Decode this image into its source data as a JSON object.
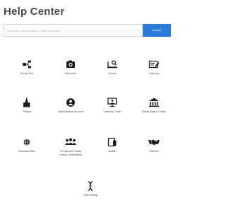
{
  "header": {
    "title": "Help Center"
  },
  "search": {
    "placeholder": "Don't see what you need? Search for more.",
    "value": "",
    "button_label": "Search"
  },
  "tiles": [
    {
      "label": "Family Tree",
      "icon": "family-tree-icon"
    },
    {
      "label": "Memories",
      "icon": "camera-icon"
    },
    {
      "label": "Search",
      "icon": "search-records-icon"
    },
    {
      "label": "Indexing",
      "icon": "indexing-icon"
    },
    {
      "label": "Temple",
      "icon": "temple-icon"
    },
    {
      "label": "FamilySearch Account",
      "icon": "account-icon"
    },
    {
      "label": "Learning Center",
      "icon": "learning-center-icon"
    },
    {
      "label": "Family History Center",
      "icon": "family-history-center-icon"
    },
    {
      "label": "Research Wiki",
      "icon": "globe-icon"
    },
    {
      "label": "Temple and Family\nHistory Consultants",
      "icon": "consultants-icon"
    },
    {
      "label": "Mobile",
      "icon": "mobile-icon"
    },
    {
      "label": "Partners",
      "icon": "handshake-icon"
    },
    {
      "label": "DNA Testing",
      "icon": "dna-icon"
    }
  ],
  "colors": {
    "accent": "#2b7bd8",
    "icon": "#1e1e1e",
    "title": "#4a4a4a"
  }
}
